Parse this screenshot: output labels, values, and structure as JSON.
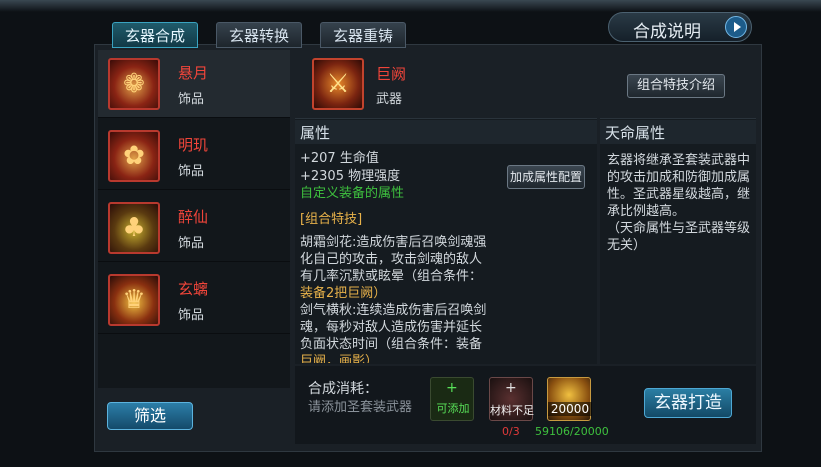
{
  "tabs": [
    "玄器合成",
    "玄器转换",
    "玄器重铸"
  ],
  "help_button": "合成说明",
  "items": [
    {
      "name": "悬月",
      "type": "饰品",
      "icon": "lantern-icon"
    },
    {
      "name": "明玑",
      "type": "饰品",
      "icon": "pot-icon"
    },
    {
      "name": "醉仙",
      "type": "饰品",
      "icon": "gourd-icon"
    },
    {
      "name": "玄螭",
      "type": "饰品",
      "icon": "chest-icon"
    }
  ],
  "filter_button": "筛选",
  "weapon": {
    "name": "巨阙",
    "type": "武器",
    "icon": "sword-icon"
  },
  "combo_intro_button": "组合特技介绍",
  "attributes": {
    "header": "属性",
    "stats": [
      "+207 生命值",
      "+2305 物理强度"
    ],
    "custom": "自定义装备的属性",
    "config_button": "加成属性配置",
    "combo_title": "[组合特技]",
    "skill1_line1": "胡霜剑花:造成伤害后召唤剑魂强",
    "skill1_line2": "化自己的攻击，攻击剑魂的敌人",
    "skill1_line3": "有几率沉默或眩晕（组合条件：",
    "skill1_line4": "装备2把巨阙）",
    "skill2_line1": "剑气横秋:连续造成伤害后召唤剑",
    "skill2_line2": "魂，每秒对敌人造成伤害并延长",
    "skill2_line3": "负面状态时间（组合条件：装备",
    "skill2_line4": "巨阙，画影）"
  },
  "fate": {
    "header": "天命属性",
    "line1": "玄器将继承圣套装武器中",
    "line2": "的攻击加成和防御加成属",
    "line3": "性。圣武器星级越高，继",
    "line4": "承比例越高。",
    "line5": "（天命属性与圣武器等级",
    "line6": "无关）"
  },
  "cost": {
    "label": "合成消耗：",
    "hint": "请添加圣套装武器",
    "slot1": "可添加",
    "slot2": "材料不足",
    "slot2_count": "0/3",
    "slot3": "20000",
    "gold_count": "59106/20000"
  },
  "forge_button": "玄器打造",
  "colors": {
    "item_name": "#f0453a",
    "green": "#3ec03e",
    "gold": "#e8b24a",
    "accent": "#2a7ea4"
  }
}
